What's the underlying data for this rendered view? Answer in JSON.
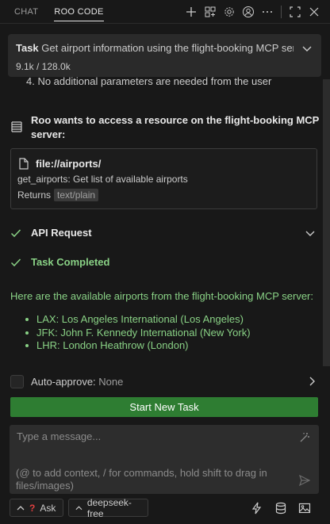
{
  "tabs": [
    {
      "label": "CHAT",
      "active": false
    },
    {
      "label": "ROO CODE",
      "active": true
    }
  ],
  "top_icons": [
    "plus-icon",
    "history-icon",
    "settings-icon",
    "account-icon",
    "more-icon",
    "fullscreen-icon",
    "close-icon"
  ],
  "task": {
    "label": "Task",
    "title": "Get airport information using the flight-booking MCP server",
    "tokens": "9.1k / 128.0k"
  },
  "previous_line": "4. No additional parameters are needed from the user",
  "access_request": {
    "text": "Roo wants to access a resource on the flight-booking MCP server:",
    "uri": "file://airports/",
    "description": "get_airports: Get list of available airports",
    "returns_label": "Returns",
    "mime_type": "text/plain"
  },
  "api_request": {
    "label": "API Request"
  },
  "task_completed": {
    "label": "Task Completed"
  },
  "answer": {
    "intro": "Here are the available airports from the flight-booking MCP server:",
    "items": [
      "LAX: Los Angeles International (Los Angeles)",
      "JFK: John F. Kennedy International (New York)",
      "LHR: London Heathrow (London)"
    ]
  },
  "auto_approve": {
    "label": "Auto-approve:",
    "value": "None"
  },
  "start_button": "Start New Task",
  "input": {
    "placeholder": "Type a message...",
    "hint": "(@ to add context, / for commands, hold shift to drag in files/images)"
  },
  "bottom": {
    "mode": "Ask",
    "model": "deepseek-free"
  },
  "colors": {
    "background": "#181818",
    "success_green": "#89d185",
    "button_green": "#2e7d32",
    "task_panel": "#2a2a2a"
  }
}
